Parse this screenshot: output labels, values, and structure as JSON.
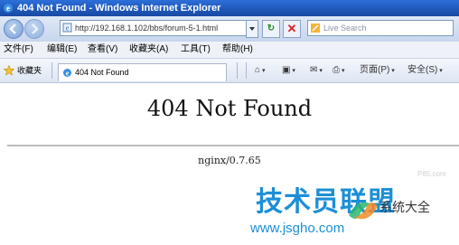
{
  "window": {
    "title": "404 Not Found - Windows Internet Explorer"
  },
  "address": {
    "url": "http://192.168.1.102/bbs/forum-5-1.html"
  },
  "search": {
    "placeholder": "Live Search"
  },
  "menu": [
    "文件(F)",
    "编辑(E)",
    "查看(V)",
    "收藏夹(A)",
    "工具(T)",
    "帮助(H)"
  ],
  "favorites": {
    "label": "收藏夹"
  },
  "tab": {
    "label": "404 Not Found"
  },
  "toolbar": {
    "page_label": "页面(P)",
    "safety_label": "安全(S)"
  },
  "page": {
    "heading": "404 Not Found",
    "server": "nginx/0.7.65"
  },
  "watermark": {
    "small": "P85.com",
    "main": "技术员联盟",
    "side": "系统大全",
    "url": "www.jsgho.com"
  }
}
